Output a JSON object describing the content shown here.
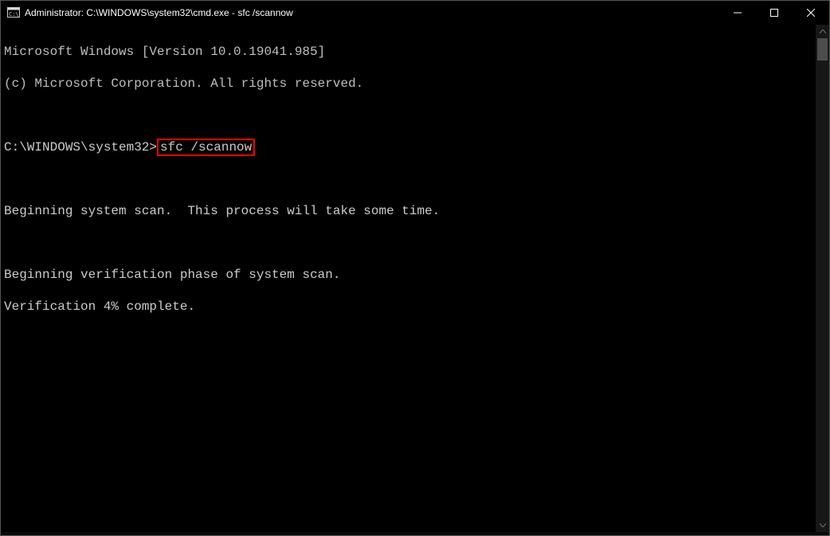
{
  "window": {
    "title": "Administrator: C:\\WINDOWS\\system32\\cmd.exe - sfc  /scannow"
  },
  "console": {
    "line1": "Microsoft Windows [Version 10.0.19041.985]",
    "line2": "(c) Microsoft Corporation. All rights reserved.",
    "blank": "",
    "prompt": "C:\\WINDOWS\\system32>",
    "command": "sfc /scannow",
    "scan_begin": "Beginning system scan.  This process will take some time.",
    "verify_begin": "Beginning verification phase of system scan.",
    "verify_progress": "Verification 4% complete."
  }
}
